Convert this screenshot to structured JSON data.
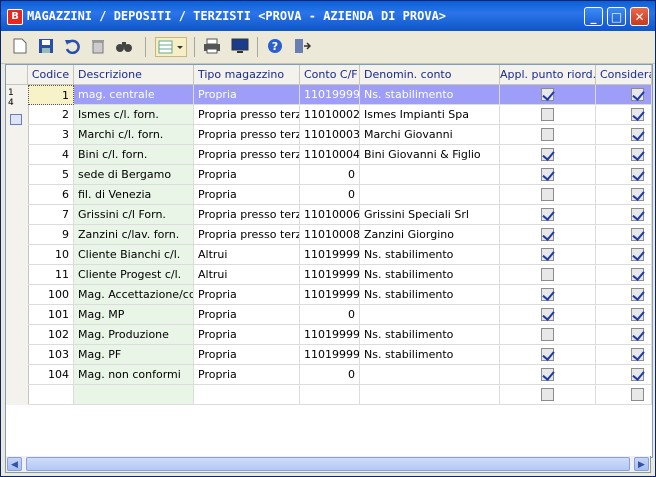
{
  "window": {
    "title": "MAGAZZINI / DEPOSITI / TERZISTI <PROVA - AZIENDA DI PROVA>",
    "icon": "app-logo-icon",
    "min_label": "_",
    "max_label": "□",
    "close_label": "✕"
  },
  "toolbar": [
    {
      "name": "new-icon"
    },
    {
      "name": "save-icon"
    },
    {
      "name": "undo-icon"
    },
    {
      "name": "delete-icon"
    },
    {
      "name": "find-icon"
    },
    {
      "name": "grid-options-icon"
    },
    {
      "name": "print-icon"
    },
    {
      "name": "preview-icon"
    },
    {
      "name": "help-icon"
    },
    {
      "name": "exit-icon"
    }
  ],
  "columns": [
    "Codice",
    "Descrizione",
    "Tipo magazzino",
    "Conto C/F",
    "Denomin. conto",
    "Appl. punto riord.",
    "Considera"
  ],
  "rowheader": {
    "count_top": "1",
    "count_bottom": "4"
  },
  "rows": [
    {
      "codice": "1",
      "descrizione": "mag. centrale",
      "tipo": "Propria",
      "conto": "11019999",
      "denomin": "Ns. stabilimento",
      "appl": true,
      "cons": true
    },
    {
      "codice": "2",
      "descrizione": "Ismes c/l. forn.",
      "tipo": "Propria presso terzi",
      "conto": "11010002",
      "denomin": "Ismes Impianti Spa",
      "appl": false,
      "cons": true
    },
    {
      "codice": "3",
      "descrizione": "Marchi c/l. forn.",
      "tipo": "Propria presso terzi",
      "conto": "11010003",
      "denomin": "Marchi Giovanni",
      "appl": false,
      "cons": true
    },
    {
      "codice": "4",
      "descrizione": "Bini c/l. forn.",
      "tipo": "Propria presso terzi",
      "conto": "11010004",
      "denomin": "Bini Giovanni & Figlio",
      "appl": true,
      "cons": true
    },
    {
      "codice": "5",
      "descrizione": "sede di Bergamo",
      "tipo": "Propria",
      "conto": "0",
      "denomin": "",
      "appl": true,
      "cons": true
    },
    {
      "codice": "6",
      "descrizione": "fil. di Venezia",
      "tipo": "Propria",
      "conto": "0",
      "denomin": "",
      "appl": false,
      "cons": true
    },
    {
      "codice": "7",
      "descrizione": "Grissini c/l Forn.",
      "tipo": "Propria presso terzi",
      "conto": "11010006",
      "denomin": "Grissini Speciali Srl",
      "appl": true,
      "cons": true
    },
    {
      "codice": "9",
      "descrizione": "Zanzini c/lav. forn.",
      "tipo": "Propria presso terzi",
      "conto": "11010008",
      "denomin": "Zanzini Giorgino",
      "appl": true,
      "cons": true
    },
    {
      "codice": "10",
      "descrizione": "Cliente Bianchi c/l.",
      "tipo": "Altrui",
      "conto": "11019999",
      "denomin": "Ns. stabilimento",
      "appl": true,
      "cons": true
    },
    {
      "codice": "11",
      "descrizione": "Cliente Progest c/l.",
      "tipo": "Altrui",
      "conto": "11019999",
      "denomin": "Ns. stabilimento",
      "appl": false,
      "cons": true
    },
    {
      "codice": "100",
      "descrizione": "Mag. Accettazione/cq",
      "tipo": "Propria",
      "conto": "11019999",
      "denomin": "Ns. stabilimento",
      "appl": true,
      "cons": true
    },
    {
      "codice": "101",
      "descrizione": "Mag. MP",
      "tipo": "Propria",
      "conto": "0",
      "denomin": "",
      "appl": true,
      "cons": true
    },
    {
      "codice": "102",
      "descrizione": "Mag. Produzione",
      "tipo": "Propria",
      "conto": "11019999",
      "denomin": "Ns. stabilimento",
      "appl": false,
      "cons": true
    },
    {
      "codice": "103",
      "descrizione": "Mag. PF",
      "tipo": "Propria",
      "conto": "11019999",
      "denomin": "Ns. stabilimento",
      "appl": true,
      "cons": true
    },
    {
      "codice": "104",
      "descrizione": "Mag. non conformi",
      "tipo": "Propria",
      "conto": "0",
      "denomin": "",
      "appl": true,
      "cons": true
    },
    {
      "codice": "",
      "descrizione": "",
      "tipo": "",
      "conto": "",
      "denomin": "",
      "appl": false,
      "cons": false
    }
  ],
  "scroll": {
    "left_label": "◀",
    "right_label": "▶"
  }
}
